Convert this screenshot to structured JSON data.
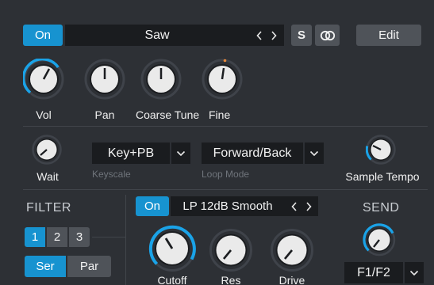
{
  "header": {
    "on_label": "On",
    "preset_name": "Saw",
    "prev_icon": "chevron-left-icon",
    "next_icon": "chevron-right-icon",
    "solo_label": "S",
    "link_icon": "link-rings-icon",
    "edit_label": "Edit"
  },
  "knobs_top": [
    {
      "label": "Vol",
      "level": 0.6,
      "ring": "blue",
      "icon": "volume-knob"
    },
    {
      "label": "Pan",
      "level": 0.5,
      "ring": "none",
      "icon": "pan-knob"
    },
    {
      "label": "Coarse Tune",
      "level": 0.5,
      "ring": "none",
      "icon": "coarse-tune-knob"
    },
    {
      "label": "Fine",
      "level": 0.53,
      "ring": "orange-dot",
      "icon": "fine-tune-knob"
    }
  ],
  "middle": {
    "wait_label": "Wait",
    "keyscale_value": "Key+PB",
    "keyscale_label": "Keyscale",
    "loop_mode_value": "Forward/Back",
    "loop_mode_label": "Loop Mode",
    "sample_tempo_label": "Sample Tempo"
  },
  "filter": {
    "title": "FILTER",
    "segments": [
      "1",
      "2",
      "3"
    ],
    "active_segment": "1",
    "routing": [
      "Ser",
      "Par"
    ],
    "active_routing": "Ser",
    "on_label": "On",
    "type_value": "LP 12dB Smooth",
    "knobs": [
      {
        "label": "Cutoff",
        "level": 0.42
      },
      {
        "label": "Res",
        "level": 0.28
      },
      {
        "label": "Drive",
        "level": 0.28
      }
    ]
  },
  "send": {
    "title": "SEND",
    "value": "F1/F2"
  },
  "colors": {
    "background": "#2d3035",
    "accent": "#1793d0",
    "field": "#1a1c1f",
    "button_gray": "#4f5359",
    "indicator_orange": "#e8883a"
  }
}
